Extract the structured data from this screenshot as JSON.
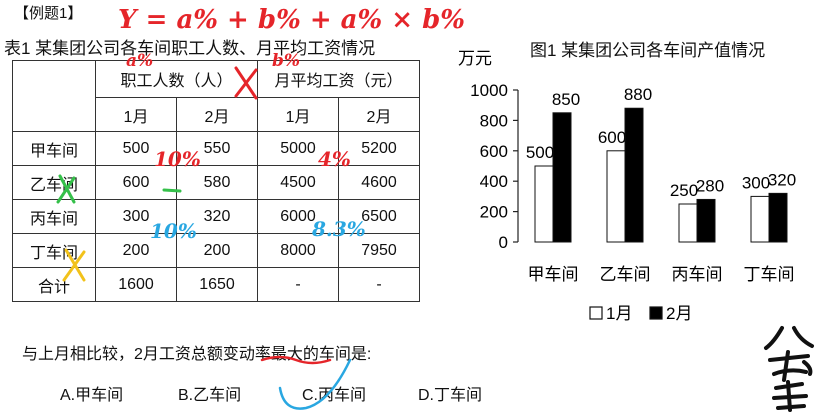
{
  "example_label": "【例题1】",
  "table": {
    "title": "表1  某集团公司各车间职工人数、月平均工资情况",
    "header_groups": [
      "职工人数（人）",
      "月平均工资（元）"
    ],
    "months": [
      "1月",
      "2月",
      "1月",
      "2月"
    ],
    "rows": [
      {
        "name": "甲车间",
        "cells": [
          "500",
          "550",
          "5000",
          "5200"
        ]
      },
      {
        "name": "乙车间",
        "cells": [
          "600",
          "580",
          "4500",
          "4600"
        ]
      },
      {
        "name": "丙车间",
        "cells": [
          "300",
          "320",
          "6000",
          "6500"
        ]
      },
      {
        "name": "丁车间",
        "cells": [
          "200",
          "200",
          "8000",
          "7950"
        ]
      },
      {
        "name": "合计",
        "cells": [
          "1600",
          "1650",
          "-",
          "-"
        ]
      }
    ]
  },
  "question": "与上月相比较，2月工资总额变动率最大的车间是:",
  "options": [
    "A.甲车间",
    "B.乙车间",
    "C.丙车间",
    "D.丁车间"
  ],
  "annotations": {
    "formula": "Y = a% + b% + a% × b%",
    "pct_row1": "10%",
    "pct_row1_salary": "4%",
    "pct_row3": "10%",
    "pct_row3_salary": "8.3%",
    "minus": "-",
    "header_a": "a%",
    "header_b": "b%",
    "colors": {
      "red": "#e5252a",
      "blue": "#29a7e1",
      "green": "#35c04a",
      "yellow": "#f2c21b"
    }
  },
  "chart_data": {
    "type": "bar",
    "title": "图1  某集团公司各车间产值情况",
    "ylabel": "万元",
    "ylim": [
      0,
      1000
    ],
    "yticks": [
      0,
      200,
      400,
      600,
      800,
      1000
    ],
    "categories": [
      "甲车间",
      "乙车间",
      "丙车间",
      "丁车间"
    ],
    "series": [
      {
        "name": "1月",
        "values": [
          500,
          600,
          250,
          300
        ],
        "fill": "#ffffff"
      },
      {
        "name": "2月",
        "values": [
          850,
          880,
          280,
          320
        ],
        "fill": "#000000"
      }
    ],
    "legend_position": "bottom",
    "grid": false
  }
}
